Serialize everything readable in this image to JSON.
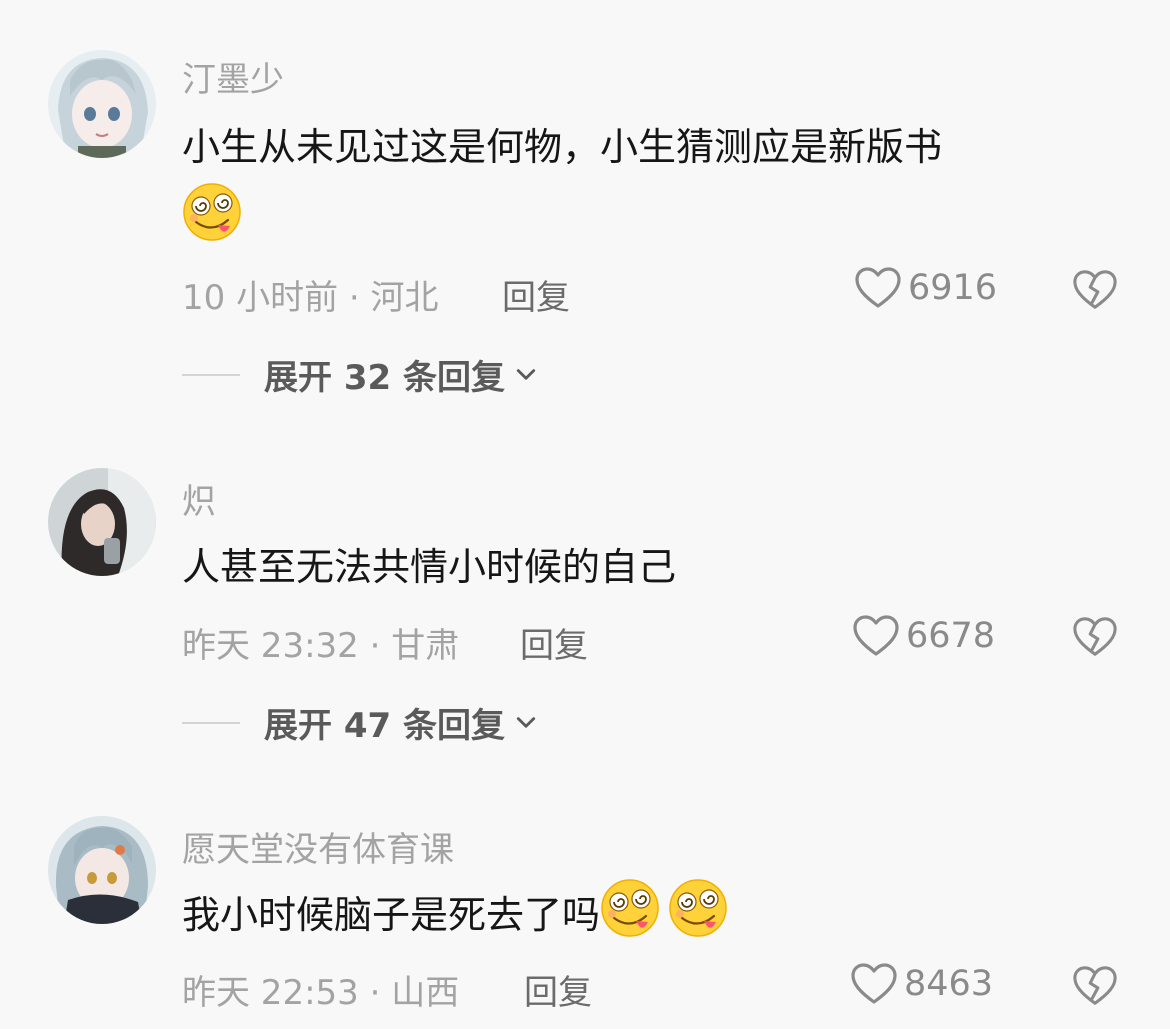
{
  "comments": [
    {
      "username": "汀墨少",
      "text": "小生从未见过这是何物，小生猜测应是新版书",
      "emojis": [
        "dizzy-tongue-emoji"
      ],
      "time_location": "10 小时前 · 河北",
      "reply_label": "回复",
      "likes": "6916",
      "expand_label": "展开 32 条回复"
    },
    {
      "username": "炽",
      "text": "人甚至无法共情小时候的自己",
      "emojis": [],
      "time_location": "昨天 23:32 · 甘肃",
      "reply_label": "回复",
      "likes": "6678",
      "expand_label": "展开 47 条回复"
    },
    {
      "username": "愿天堂没有体育课",
      "text": "我小时候脑子是死去了吗",
      "emojis": [
        "dizzy-tongue-emoji",
        "dizzy-tongue-emoji"
      ],
      "time_location": "昨天 22:53 · 山西",
      "reply_label": "回复",
      "likes": "8463"
    }
  ],
  "icons": {
    "like": "heart-outline-icon",
    "dislike": "broken-heart-icon",
    "expand": "chevron-down-icon"
  },
  "colors": {
    "background": "#f8f8f8",
    "text_primary": "#161616",
    "text_secondary": "#a3a3a3"
  }
}
